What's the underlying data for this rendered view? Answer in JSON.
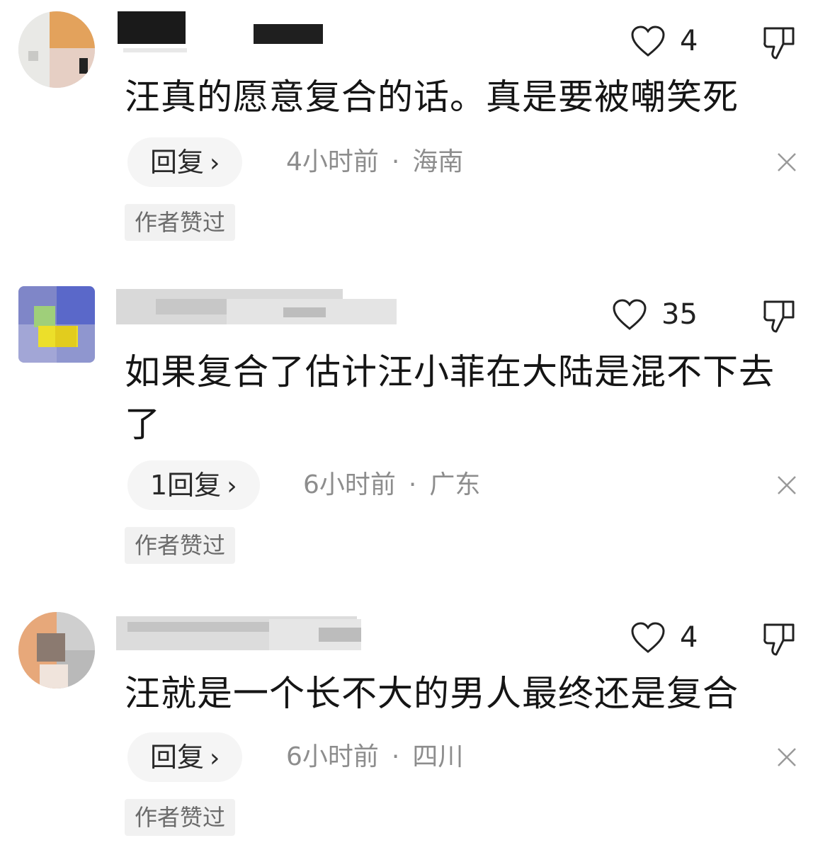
{
  "comments": [
    {
      "likes": "4",
      "text": "汪真的愿意复合的话。真是要被嘲笑死",
      "reply_label": "回复",
      "reply_chevron": "›",
      "time": "4小时前",
      "separator": "·",
      "location": "海南",
      "badge": "作者赞过"
    },
    {
      "likes": "35",
      "text": "如果复合了估计汪小菲在大陆是混不下去了",
      "reply_label": "1回复",
      "reply_chevron": "›",
      "time": "6小时前",
      "separator": "·",
      "location": "广东",
      "badge": "作者赞过"
    },
    {
      "likes": "4",
      "text": "汪就是一个长不大的男人最终还是复合",
      "reply_label": "回复",
      "reply_chevron": "›",
      "time": "6小时前",
      "separator": "·",
      "location": "四川",
      "badge": "作者赞过"
    }
  ],
  "icons": {
    "like": "heart-outline-icon",
    "dislike": "thumbs-down-outline-icon",
    "dismiss": "close-icon"
  },
  "colors": {
    "text": "#151515",
    "meta": "#8d8d8d",
    "pill_bg": "#f5f5f5",
    "badge_bg": "#f1f1f1"
  }
}
